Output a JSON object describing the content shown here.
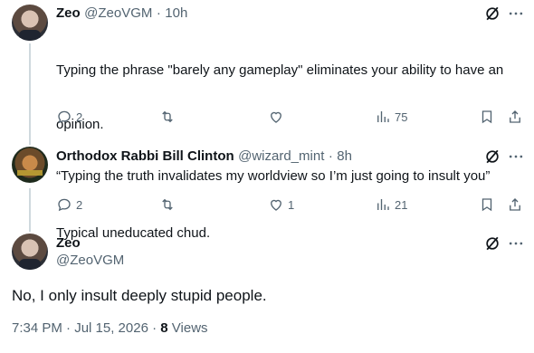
{
  "tweets": [
    {
      "name": "Zeo",
      "handle": "@ZeoVGM",
      "time": "10h",
      "text_line1": "Typing the phrase \"barely any gameplay\" eliminates your ability to have an",
      "text_line2": "opinion.",
      "text_line3": "Typical uneducated chud.",
      "replies": "2",
      "retweets": "",
      "likes": "",
      "views": "75"
    },
    {
      "name": "Orthodox Rabbi Bill Clinton",
      "handle": "@wizard_mint",
      "time": "8h",
      "text": "“Typing the truth invalidates my worldview so I’m just going to insult you”",
      "replies": "2",
      "retweets": "",
      "likes": "1",
      "views": "21"
    }
  ],
  "main_tweet": {
    "name": "Zeo",
    "handle": "@ZeoVGM",
    "text": "No, I only insult deeply stupid people.",
    "timestamp": "7:34 PM · Jul 15, 2026 ·",
    "views_count": "8",
    "views_label": "Views"
  },
  "separator": "·",
  "icons": [
    "grok-icon",
    "more-icon",
    "reply-icon",
    "retweet-icon",
    "like-icon",
    "views-icon",
    "bookmark-icon",
    "share-icon"
  ]
}
